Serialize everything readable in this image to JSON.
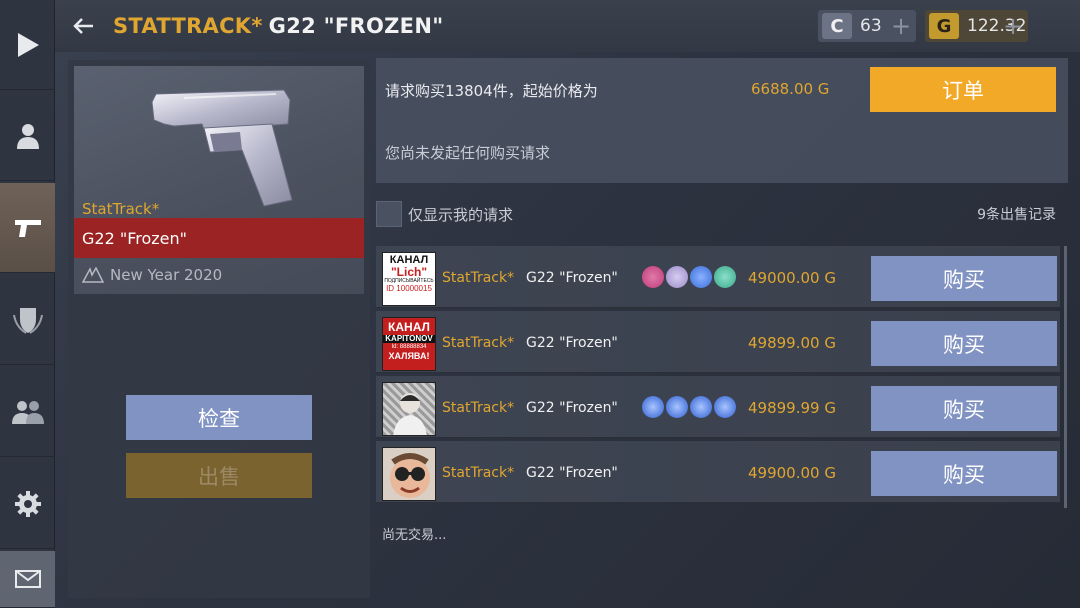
{
  "header": {
    "stattrack": "STATTRACK*",
    "item_name": "G22 \"FROZEN\""
  },
  "wallet": {
    "credits_symbol": "C",
    "credits": "63",
    "gold_symbol": "G",
    "gold": "122.32",
    "plus": "+"
  },
  "rail": {
    "items": [
      {
        "name": "play-icon"
      },
      {
        "name": "profile-icon"
      },
      {
        "name": "pistol-icon",
        "active": true
      },
      {
        "name": "clan-shield-icon"
      },
      {
        "name": "friends-icon"
      },
      {
        "name": "settings-gear-icon"
      },
      {
        "name": "mail-icon"
      }
    ]
  },
  "item": {
    "stattrack_label": "StatTrack*",
    "name": "G22 \"Frozen\"",
    "collection": "New Year 2020",
    "inspect_label": "检查",
    "sell_label": "出售"
  },
  "request": {
    "text": "请求购买13804件，起始价格为",
    "price": "6688.00 G",
    "order_label": "订单",
    "none_text": "您尚未发起任何购买请求"
  },
  "filter": {
    "label": "仅显示我的请求",
    "sales_count": "9条出售记录"
  },
  "listings": [
    {
      "stattrack": "StatTrack*",
      "name": "G22 \"Frozen\"",
      "price": "49000.00 G",
      "buy_label": "购买",
      "avatar": {
        "lines": [
          "КАНАЛ",
          "\"Lich\"",
          "ПОДПИСЫВАЙТЕСЬ",
          "ID 10000015"
        ]
      },
      "stickers": [
        "#c03a7a",
        "#9a8ac8",
        "#3a6ed8",
        "#3aa88a"
      ]
    },
    {
      "stattrack": "StatTrack*",
      "name": "G22 \"Frozen\"",
      "price": "49899.00 G",
      "buy_label": "购买",
      "avatar": {
        "lines": [
          "КАНАЛ",
          "KAPITONOV",
          "Id: 88888834",
          "ХАЛЯВА!"
        ]
      },
      "stickers": []
    },
    {
      "stattrack": "StatTrack*",
      "name": "G22 \"Frozen\"",
      "price": "49899.99 G",
      "buy_label": "购买",
      "avatar": {
        "lines": []
      },
      "stickers": [
        "#2f5fd0",
        "#2f5fd0",
        "#2f5fd0",
        "#2f5fd0"
      ]
    },
    {
      "stattrack": "StatTrack*",
      "name": "G22 \"Frozen\"",
      "price": "49900.00 G",
      "buy_label": "购买",
      "avatar": {
        "lines": []
      },
      "stickers": []
    }
  ],
  "footer": {
    "no_trades": "尚无交易..."
  },
  "colors": {
    "accent_gold": "#e0a630",
    "order_button": "#f2a928",
    "buy_button": "#8193c3",
    "name_bar": "#9b2323"
  }
}
